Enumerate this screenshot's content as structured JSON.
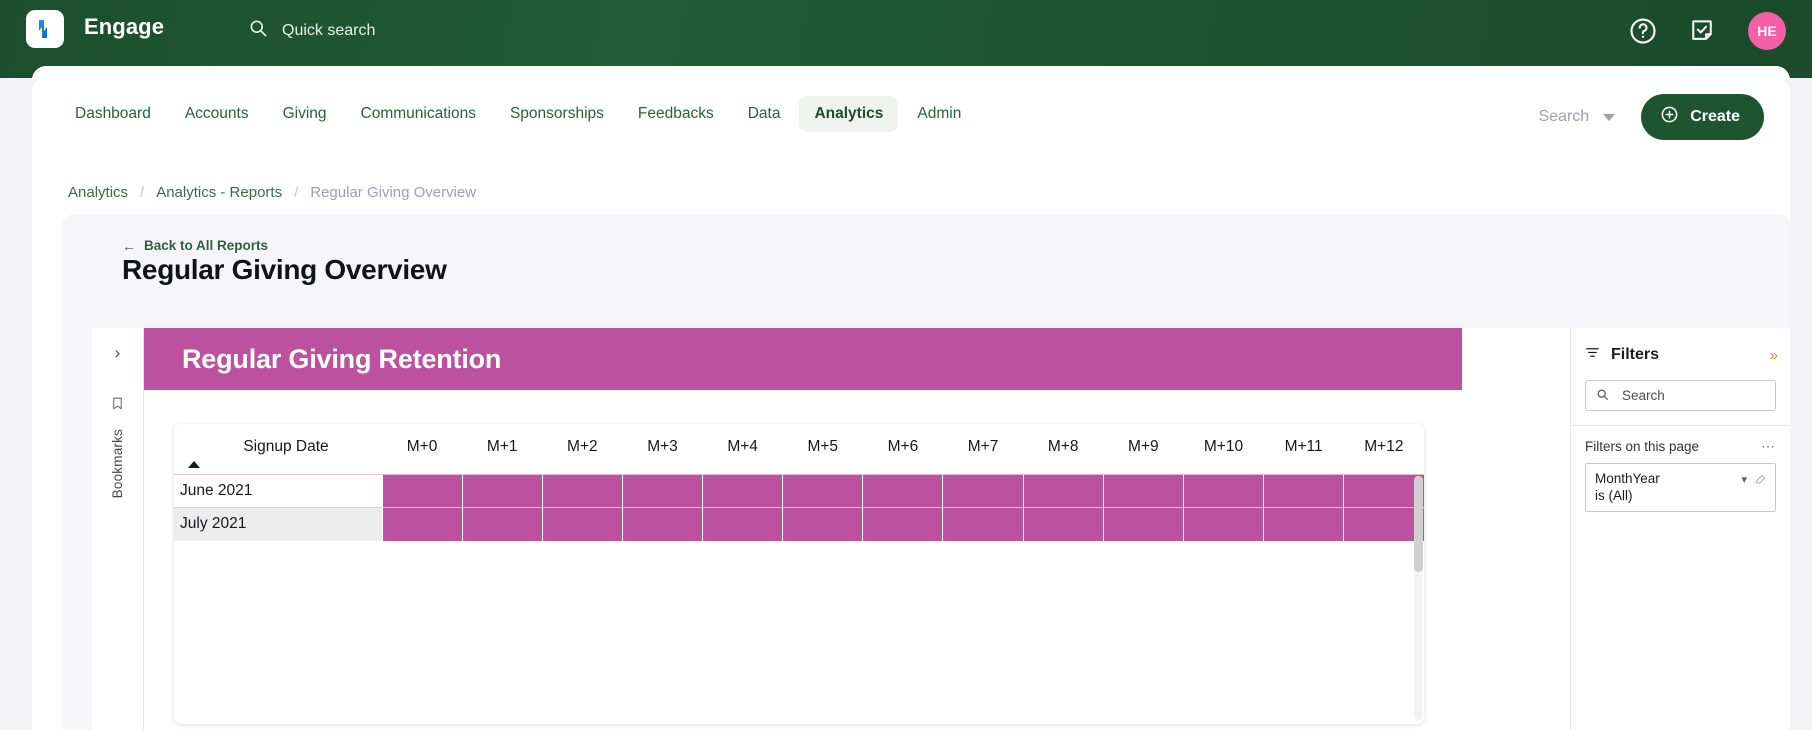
{
  "topbar": {
    "brand": "Engage",
    "logo_icon": "pulse-logo-icon",
    "quick_search_label": "Quick search",
    "search_icon": "search-icon",
    "help_icon": "help-circle-icon",
    "tasks_icon": "note-check-icon",
    "avatar_initials": "HE",
    "bg_color": "#1d5530",
    "avatar_color": "#f45fa8"
  },
  "nav": {
    "items": [
      {
        "label": "Dashboard",
        "active": false
      },
      {
        "label": "Accounts",
        "active": false
      },
      {
        "label": "Giving",
        "active": false
      },
      {
        "label": "Communications",
        "active": false
      },
      {
        "label": "Sponsorships",
        "active": false
      },
      {
        "label": "Feedbacks",
        "active": false
      },
      {
        "label": "Data",
        "active": false
      },
      {
        "label": "Analytics",
        "active": true
      },
      {
        "label": "Admin",
        "active": false
      }
    ],
    "search_label": "Search",
    "search_caret_icon": "caret-down-icon",
    "create_label": "Create",
    "create_icon": "plus-circle-icon"
  },
  "breadcrumb": {
    "items": [
      "Analytics",
      "Analytics - Reports",
      "Regular Giving Overview"
    ],
    "separator": "/"
  },
  "report": {
    "back_label": "Back to All Reports",
    "back_icon": "arrow-left-icon",
    "title": "Regular Giving Overview"
  },
  "bookmarks_rail": {
    "chevron_icon": "chevron-right-icon",
    "bookmark_icon": "bookmark-icon",
    "label": "Bookmarks"
  },
  "visual": {
    "banner_title": "Regular Giving Retention",
    "banner_color": "#bc519f",
    "cell_color": "#bc519f",
    "sort_icon": "sort-ascending-triangle-icon"
  },
  "filters": {
    "panel_icon": "filter-icon",
    "title": "Filters",
    "expand_icon": "chevrons-right-icon",
    "search_icon": "search-icon",
    "search_placeholder": "Search",
    "section_label": "Filters on this page",
    "more_icon": "ellipsis-icon",
    "cards": [
      {
        "field": "MonthYear",
        "value": "is (All)",
        "chevron_icon": "chevron-down-icon",
        "clear_icon": "eraser-icon"
      }
    ]
  },
  "chart_data": {
    "type": "heatmap",
    "title": "Regular Giving Retention",
    "row_header": "Signup Date",
    "categories": [
      "M+0",
      "M+1",
      "M+2",
      "M+3",
      "M+4",
      "M+5",
      "M+6",
      "M+7",
      "M+8",
      "M+9",
      "M+10",
      "M+11",
      "M+12"
    ],
    "rows": [
      {
        "label": "June 2021",
        "values": [
          1,
          1,
          1,
          1,
          1,
          1,
          1,
          1,
          1,
          1,
          1,
          1,
          1
        ]
      },
      {
        "label": "July 2021",
        "values": [
          1,
          1,
          1,
          1,
          1,
          1,
          1,
          1,
          1,
          1,
          1,
          1,
          1
        ]
      }
    ],
    "xlabel": "",
    "ylabel": "Signup Date",
    "legend": "none",
    "grid": true,
    "sort_column": "Signup Date",
    "sort_direction": "ascending"
  }
}
